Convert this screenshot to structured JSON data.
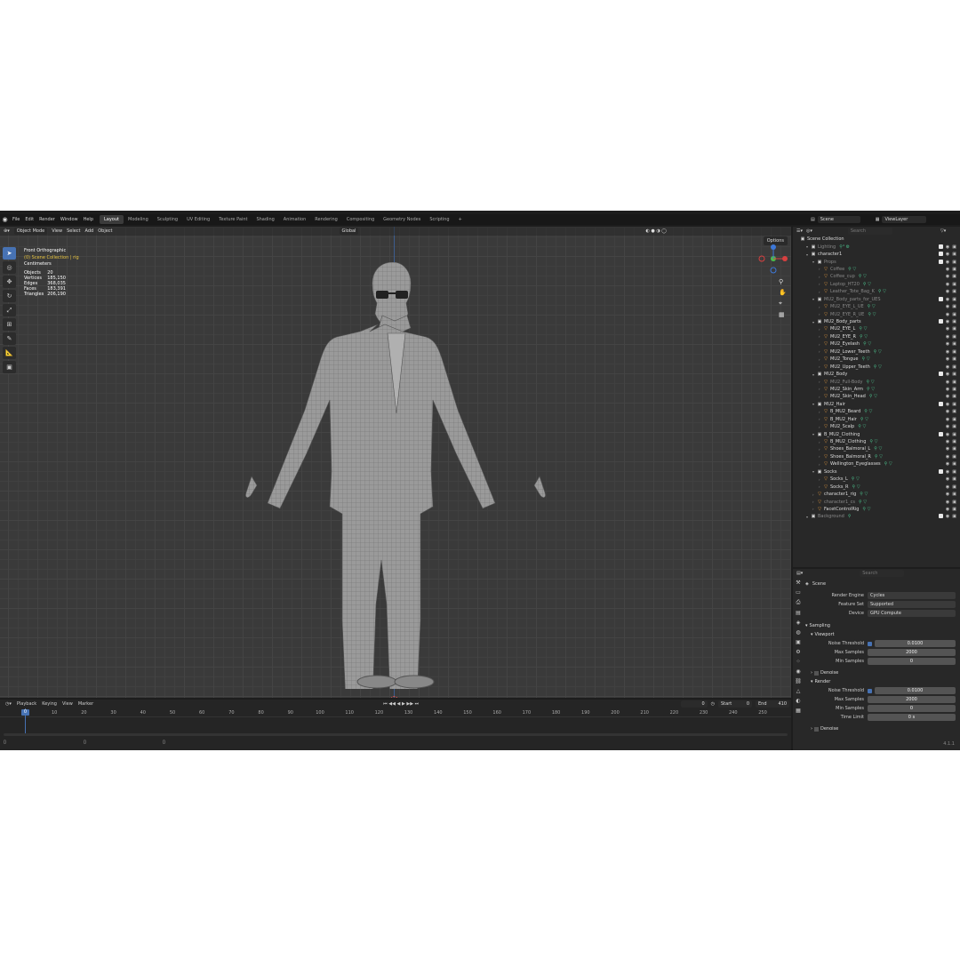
{
  "menu": [
    "File",
    "Edit",
    "Render",
    "Window",
    "Help"
  ],
  "workspaces": [
    "Layout",
    "Modeling",
    "Sculpting",
    "UV Editing",
    "Texture Paint",
    "Shading",
    "Animation",
    "Rendering",
    "Compositing",
    "Geometry Nodes",
    "Scripting",
    "+"
  ],
  "active_workspace": "Layout",
  "scene_name": "Scene",
  "view_layer": "ViewLayer",
  "viewport": {
    "mode": "Object Mode",
    "menus": [
      "View",
      "Select",
      "Add",
      "Object"
    ],
    "orientation": "Global",
    "options": "Options",
    "view_name": "Front Orthographic",
    "collection_path": "(0) Scene Collection | rig",
    "units": "Centimeters",
    "stats": [
      [
        "Objects",
        "20"
      ],
      [
        "Vertices",
        "185,150"
      ],
      [
        "Edges",
        "368,035"
      ],
      [
        "Faces",
        "183,391"
      ],
      [
        "Triangles",
        "206,190"
      ]
    ]
  },
  "timeline": {
    "menus": [
      "Playback",
      "Keying",
      "View",
      "Marker"
    ],
    "current_frame": "0",
    "start_label": "Start",
    "start": "0",
    "end_label": "End",
    "end": "410",
    "ticks": [
      "0",
      "10",
      "20",
      "30",
      "40",
      "50",
      "60",
      "70",
      "80",
      "90",
      "100",
      "110",
      "120",
      "130",
      "140",
      "150",
      "160",
      "170",
      "180",
      "190",
      "200",
      "210",
      "220",
      "230",
      "240",
      "250"
    ]
  },
  "outliner": {
    "search_placeholder": "Search",
    "root": "Scene Collection",
    "rows": [
      {
        "indent": 1,
        "type": "col",
        "name": "Lighting",
        "dim": true,
        "mods": "⚲⁴ ⚙"
      },
      {
        "indent": 1,
        "type": "col",
        "name": "character1",
        "dim": false,
        "mods": ""
      },
      {
        "indent": 2,
        "type": "col",
        "name": "Props",
        "dim": true,
        "mods": ""
      },
      {
        "indent": 3,
        "type": "obj",
        "name": "Coffee",
        "dim": true,
        "mods": "⚲ ▽"
      },
      {
        "indent": 3,
        "type": "obj",
        "name": "Coffee_cup",
        "dim": true,
        "mods": "⚲ ▽"
      },
      {
        "indent": 3,
        "type": "obj",
        "name": "Laptop_HT20",
        "dim": true,
        "mods": "⚲ ▽"
      },
      {
        "indent": 3,
        "type": "obj",
        "name": "Leather_Tote_Bag_K",
        "dim": true,
        "mods": "⚲ ▽"
      },
      {
        "indent": 2,
        "type": "col",
        "name": "MU2_Body_parts_for_UES",
        "dim": true,
        "mods": ""
      },
      {
        "indent": 3,
        "type": "obj",
        "name": "MU2_EYE_L_UE",
        "dim": true,
        "mods": "⚲ ▽"
      },
      {
        "indent": 3,
        "type": "obj",
        "name": "MU2_EYE_R_UE",
        "dim": true,
        "mods": "⚲ ▽"
      },
      {
        "indent": 2,
        "type": "col",
        "name": "MU2_Body_parts",
        "dim": false,
        "mods": ""
      },
      {
        "indent": 3,
        "type": "obj",
        "name": "MU2_EYE_L",
        "dim": false,
        "mods": "⚲ ▽"
      },
      {
        "indent": 3,
        "type": "obj",
        "name": "MU2_EYE_R",
        "dim": false,
        "mods": "⚲ ▽"
      },
      {
        "indent": 3,
        "type": "obj",
        "name": "MU2_Eyelash",
        "dim": false,
        "mods": "⚲ ▽"
      },
      {
        "indent": 3,
        "type": "obj",
        "name": "MU2_Lower_Teeth",
        "dim": false,
        "mods": "⚲ ▽"
      },
      {
        "indent": 3,
        "type": "obj",
        "name": "MU2_Tongue",
        "dim": false,
        "mods": "⚲ ▽"
      },
      {
        "indent": 3,
        "type": "obj",
        "name": "MU2_Upper_Teeth",
        "dim": false,
        "mods": "⚲ ▽"
      },
      {
        "indent": 2,
        "type": "col",
        "name": "MU2_Body",
        "dim": false,
        "mods": ""
      },
      {
        "indent": 3,
        "type": "obj",
        "name": "MU2_Full-Body",
        "dim": true,
        "mods": "⚲ ▽"
      },
      {
        "indent": 3,
        "type": "obj",
        "name": "MU2_Skin_Arm",
        "dim": false,
        "mods": "⚲ ▽"
      },
      {
        "indent": 3,
        "type": "obj",
        "name": "MU2_Skin_Head",
        "dim": false,
        "mods": "⚲ ▽"
      },
      {
        "indent": 2,
        "type": "col",
        "name": "MU2_Hair",
        "dim": false,
        "mods": ""
      },
      {
        "indent": 3,
        "type": "obj",
        "name": "B_MU2_Beard",
        "dim": false,
        "mods": "⚲ ▽"
      },
      {
        "indent": 3,
        "type": "obj",
        "name": "B_MU2_Hair",
        "dim": false,
        "mods": "⚲ ▽"
      },
      {
        "indent": 3,
        "type": "obj",
        "name": "MU2_Scalp",
        "dim": false,
        "mods": "⚲ ▽"
      },
      {
        "indent": 2,
        "type": "col",
        "name": "B_MU2_Clothing",
        "dim": false,
        "mods": ""
      },
      {
        "indent": 3,
        "type": "obj",
        "name": "B_MU2_Clothing",
        "dim": false,
        "mods": "⚲ ▽"
      },
      {
        "indent": 3,
        "type": "obj",
        "name": "Shoes_Balmoral_L",
        "dim": false,
        "mods": "⚲ ▽"
      },
      {
        "indent": 3,
        "type": "obj",
        "name": "Shoes_Balmoral_R",
        "dim": false,
        "mods": "⚲ ▽"
      },
      {
        "indent": 3,
        "type": "obj",
        "name": "Wellington_Eyeglasses",
        "dim": false,
        "mods": "⚲ ▽"
      },
      {
        "indent": 2,
        "type": "col",
        "name": "Socks",
        "dim": false,
        "mods": ""
      },
      {
        "indent": 3,
        "type": "obj",
        "name": "Socks_L",
        "dim": false,
        "mods": "⚲ ▽"
      },
      {
        "indent": 3,
        "type": "obj",
        "name": "Socks_R",
        "dim": false,
        "mods": "⚲ ▽"
      },
      {
        "indent": 2,
        "type": "obj",
        "name": "character1_rig",
        "dim": false,
        "mods": "⚲ ▽"
      },
      {
        "indent": 2,
        "type": "obj",
        "name": "character1_cs",
        "dim": true,
        "mods": "⚲ ▽"
      },
      {
        "indent": 2,
        "type": "obj",
        "name": "FacetControlRig",
        "dim": false,
        "mods": "⚲ ▽"
      },
      {
        "indent": 1,
        "type": "col",
        "name": "Background",
        "dim": true,
        "mods": "⚲"
      }
    ]
  },
  "properties": {
    "search_placeholder": "Search",
    "context": "Scene",
    "render_engine_label": "Render Engine",
    "render_engine": "Cycles",
    "feature_set_label": "Feature Set",
    "feature_set": "Supported",
    "device_label": "Device",
    "device": "GPU Compute",
    "sampling": "Sampling",
    "viewport_section": "Viewport",
    "noise_threshold_label": "Noise Threshold",
    "viewport_noise": "0.0100",
    "max_samples_label": "Max Samples",
    "viewport_max": "2000",
    "min_samples_label": "Min Samples",
    "viewport_min": "0",
    "denoise": "Denoise",
    "render_section": "Render",
    "render_noise": "0.0100",
    "render_max": "2000",
    "render_min": "0",
    "time_limit_label": "Time Limit",
    "time_limit": "0 s"
  },
  "version": "4.1.1",
  "accent_color": "#4772b3"
}
